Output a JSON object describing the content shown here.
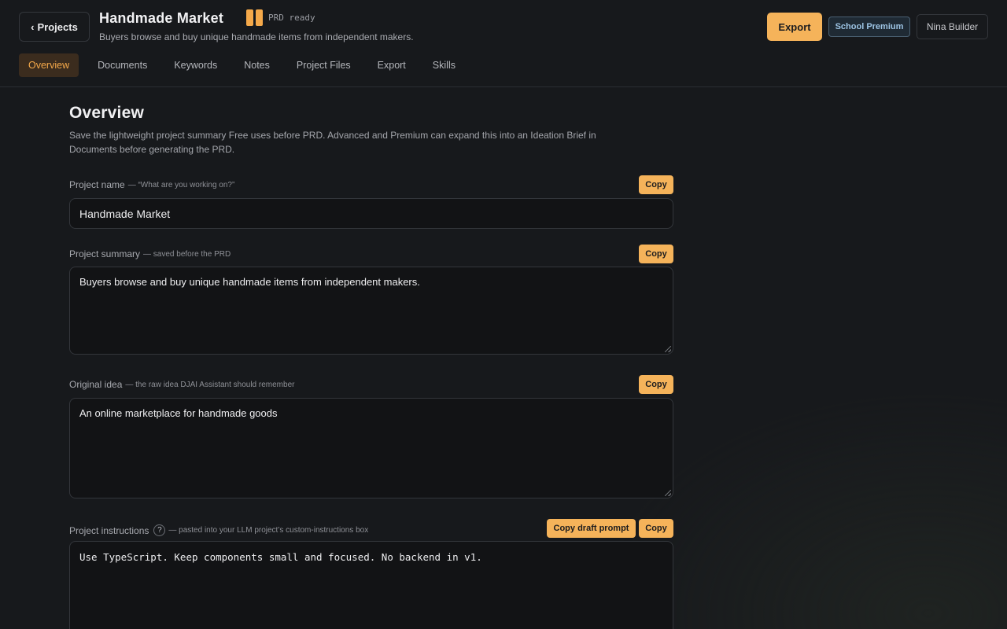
{
  "header": {
    "back_label": "Projects",
    "project_title": "Handmade Market",
    "status_text": "PRD ready",
    "project_description": "Buyers browse and buy unique handmade items from independent makers.",
    "export_label": "Export",
    "plan_badge": "School Premium",
    "user_name": "Nina Builder"
  },
  "tabs": [
    "Overview",
    "Documents",
    "Keywords",
    "Notes",
    "Project Files",
    "Export",
    "Skills"
  ],
  "active_tab": "Overview",
  "overview": {
    "title": "Overview",
    "description": "Save the lightweight project summary Free uses before PRD. Advanced and Premium can expand this into an Ideation Brief in Documents before generating the PRD.",
    "fields": {
      "project_name": {
        "label": "Project name",
        "hint": "— “What are you working on?”",
        "value": "Handmade Market",
        "copy_label": "Copy"
      },
      "project_summary": {
        "label": "Project summary",
        "hint": "— saved before the PRD",
        "value": "Buyers browse and buy unique handmade items from independent makers.",
        "copy_label": "Copy"
      },
      "original_idea": {
        "label": "Original idea",
        "hint": "— the raw idea DJAI Assistant should remember",
        "value": "An online marketplace for handmade goods",
        "copy_label": "Copy"
      },
      "project_instructions": {
        "label": "Project instructions",
        "help_glyph": "?",
        "hint": "— pasted into your LLM project’s custom-instructions box",
        "value": "Use TypeScript. Keep components small and focused. No backend in v1.",
        "copy_draft_label": "Copy draft prompt",
        "copy_label": "Copy"
      }
    }
  },
  "colors": {
    "background": "#17191c",
    "accent": "#f5b35a",
    "badge_text": "#9dc4e4"
  },
  "icons": {
    "back": "chevron-left-icon",
    "status": "status-bars-icon",
    "help": "help-circle-icon"
  }
}
